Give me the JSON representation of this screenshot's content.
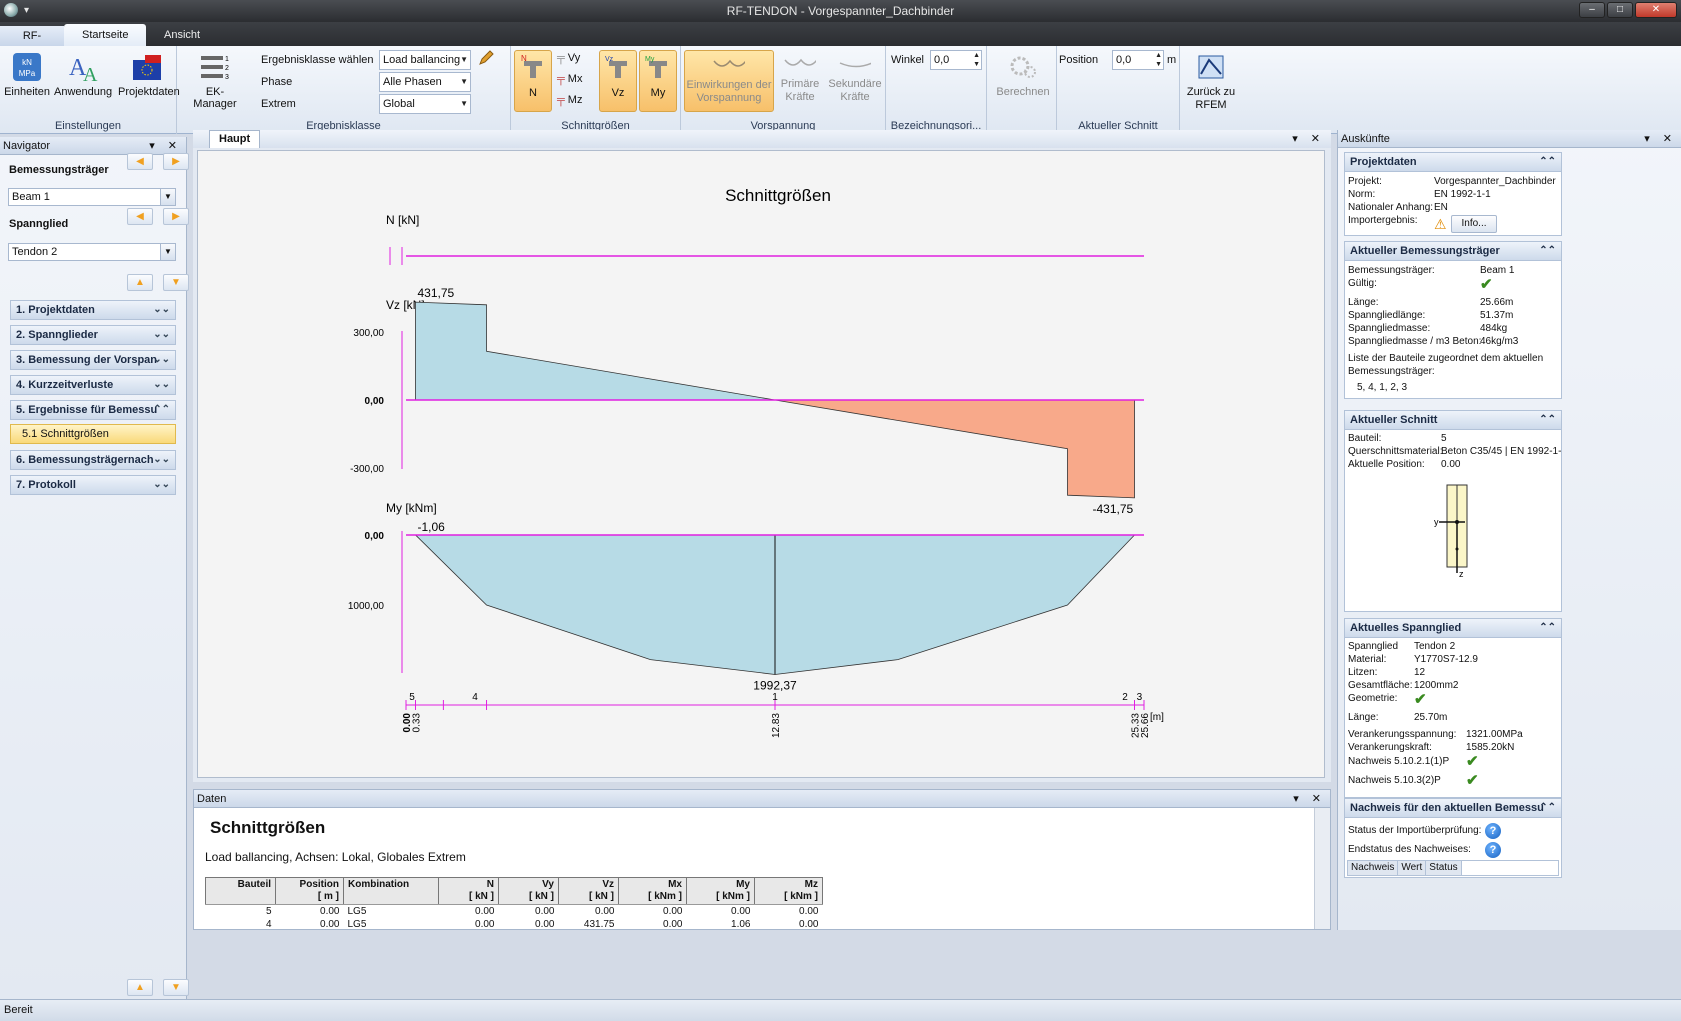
{
  "window": {
    "title": "RF-TENDON - Vorgespannter_Dachbinder",
    "app_tab": "RF-TENDON",
    "tabs": [
      "Startseite",
      "Ansicht"
    ]
  },
  "ribbon": {
    "einstellungen": {
      "label": "Einstellungen",
      "buttons": [
        "Einheiten",
        "Anwendung",
        "Projektdaten"
      ]
    },
    "ek_manager": "EK-Manager",
    "ergebnisklasse": {
      "label": "Ergebnisklasse",
      "fields": [
        {
          "label": "Ergebnisklasse wählen",
          "value": "Load ballancing"
        },
        {
          "label": "Phase",
          "value": "Alle Phasen"
        },
        {
          "label": "Extrem",
          "value": "Global"
        }
      ]
    },
    "schnittgroessen": {
      "label": "Schnittgrößen",
      "big": [
        "N",
        "Vz",
        "My"
      ],
      "small": [
        "Vy",
        "Mx",
        "Mz"
      ]
    },
    "vorspannung": {
      "label": "Vorspannung",
      "buttons": [
        "Einwirkungen der Vorspannung",
        "Primäre Kräfte",
        "Sekundäre Kräfte"
      ]
    },
    "bezeichnung": {
      "label": "Bezeichnungsori...",
      "winkel_label": "Winkel",
      "winkel_value": "0,0"
    },
    "berechnen": "Berechnen",
    "schnitt": {
      "label": "Aktueller Schnitt",
      "position_label": "Position",
      "position_value": "0,0",
      "unit": "m"
    },
    "rfem": "Zurück zu RFEM"
  },
  "navigator": {
    "title": "Navigator",
    "beam_label": "Bemessungsträger",
    "beam_value": "Beam 1",
    "tendon_label": "Spannglied",
    "tendon_value": "Tendon 2",
    "items": [
      "1. Projektdaten",
      "2. Spannglieder",
      "3. Bemessung der Vorspan",
      "4. Kurzzeitverluste",
      "5. Ergebnisse für Bemessu",
      "6. Bemessungsträgernach",
      "7. Protokoll"
    ],
    "subitem": "5.1 Schnittgrößen"
  },
  "main": {
    "tab": "Haupt"
  },
  "chart_data": {
    "type": "area",
    "title": "Schnittgrößen",
    "x_unit": "[m]",
    "x_ticks": [
      "0.00",
      "0.33",
      "12.83",
      "25.33",
      "25.66"
    ],
    "member_labels": [
      "5",
      "4",
      "1",
      "2",
      "3"
    ],
    "panels": [
      {
        "name": "N [kN]",
        "x": [
          0,
          25.66
        ],
        "y": [
          0,
          0
        ]
      },
      {
        "name": "Vz [kN]",
        "y_ticks": [
          "300,00",
          "0,00",
          "-300,00"
        ],
        "x": [
          0,
          0.33,
          0.33,
          2.8,
          2.8,
          12.83,
          23.0,
          23.0,
          25.33,
          25.33,
          25.66
        ],
        "y": [
          0,
          0,
          431.75,
          420,
          215,
          0,
          -215,
          -420,
          -431.75,
          0,
          0
        ],
        "labels": [
          "431,75",
          "-431,75"
        ]
      },
      {
        "name": "My [kNm]",
        "y_ticks": [
          "0,00",
          "1000,00"
        ],
        "x": [
          0,
          0.33,
          2.8,
          8.5,
          12.83,
          17.1,
          23.0,
          25.33,
          25.66
        ],
        "y": [
          0,
          -1.06,
          1000,
          1780,
          1992.37,
          1780,
          1000,
          0,
          0
        ],
        "labels": [
          "-1,06",
          "1992,37"
        ]
      }
    ]
  },
  "daten": {
    "title": "Daten",
    "heading": "Schnittgrößen",
    "subtitle": "Load ballancing, Achsen: Lokal, Globales Extrem",
    "columns": [
      [
        "Bauteil",
        ""
      ],
      [
        "Position",
        "[ m ]"
      ],
      [
        "Kombination",
        ""
      ],
      [
        "N",
        "[ kN ]"
      ],
      [
        "Vy",
        "[ kN ]"
      ],
      [
        "Vz",
        "[ kN ]"
      ],
      [
        "Mx",
        "[ kNm ]"
      ],
      [
        "My",
        "[ kNm ]"
      ],
      [
        "Mz",
        "[ kNm ]"
      ]
    ],
    "rows": [
      [
        "5",
        "0.00",
        "LG5",
        "0.00",
        "0.00",
        "0.00",
        "0.00",
        "0.00",
        "0.00"
      ],
      [
        "4",
        "0.00",
        "LG5",
        "0.00",
        "0.00",
        "431.75",
        "0.00",
        "1.06",
        "0.00"
      ]
    ]
  },
  "auskuenfte": {
    "title": "Auskünfte",
    "projektdaten": {
      "title": "Projektdaten",
      "rows": [
        [
          "Projekt:",
          "Vorgespannter_Dachbinder"
        ],
        [
          "Norm:",
          "EN 1992-1-1"
        ],
        [
          "Nationaler Anhang:",
          "EN"
        ],
        [
          "Importergebnis:",
          ""
        ]
      ],
      "info_button": "Info..."
    },
    "traeger": {
      "title": "Aktueller Bemessungsträger",
      "rows": [
        [
          "Bemessungsträger:",
          "Beam 1"
        ],
        [
          "Gültig:",
          ""
        ],
        [
          "Länge:",
          "25.66m"
        ],
        [
          "Spanngliedlänge:",
          "51.37m"
        ],
        [
          "Spanngliedmasse:",
          "484kg"
        ],
        [
          "Spanngliedmasse / m3 Beton:",
          "46kg/m3"
        ]
      ],
      "liste": "Liste der Bauteile zugeordnet dem aktuellen Bemessungsträger:",
      "members": "5, 4, 1, 2, 3"
    },
    "schnitt": {
      "title": "Aktueller Schnitt",
      "rows": [
        [
          "Bauteil:",
          "5"
        ],
        [
          "Querschnittsmaterial:",
          "Beton C35/45 | EN 1992-1-"
        ],
        [
          "Aktuelle Position:",
          "0.00"
        ]
      ],
      "axis_y": "y",
      "axis_z": "z"
    },
    "spannglied": {
      "title": "Aktuelles Spannglied",
      "rows": [
        [
          "Spannglied",
          "Tendon 2"
        ],
        [
          "Material:",
          "Y1770S7-12.9"
        ],
        [
          "Litzen:",
          "12"
        ],
        [
          "Gesamtfläche:",
          "1200mm2"
        ],
        [
          "Geometrie:",
          ""
        ],
        [
          "Länge:",
          "25.70m"
        ],
        [
          "Verankerungsspannung:",
          "1321.00MPa"
        ],
        [
          "Verankerungskraft:",
          "1585.20kN"
        ],
        [
          "Nachweis 5.10.2.1(1)P",
          ""
        ],
        [
          "Nachweis 5.10.3(2)P",
          ""
        ]
      ]
    },
    "nachweis": {
      "title": "Nachweis für den aktuellen Bemessu",
      "rows": [
        [
          "Status der Importüberprüfung:",
          ""
        ],
        [
          "Endstatus des Nachweises:",
          ""
        ]
      ],
      "cols": [
        "Nachweis",
        "Wert",
        "Status"
      ]
    }
  },
  "status": "Bereit",
  "colors": {
    "positive": "#b7dbe6",
    "negative": "#f8a98a",
    "axis": "#e020e0"
  }
}
